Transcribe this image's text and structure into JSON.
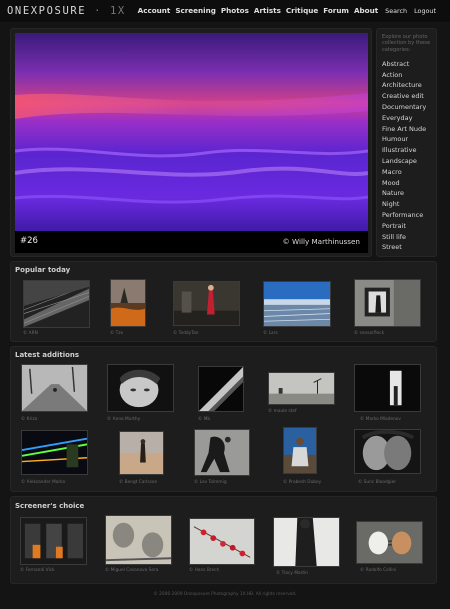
{
  "site": {
    "logo_main": "ONEXPOSURE",
    "logo_sep": "·",
    "logo_suffix": "1X"
  },
  "nav": {
    "items": [
      "Account",
      "Screening",
      "Photos",
      "Artists",
      "Critique",
      "Forum",
      "About"
    ],
    "search": "Search",
    "logout": "Logout"
  },
  "hero": {
    "number": "#26",
    "credit": "© Willy Marthinussen"
  },
  "categories": {
    "intro": "Explore our photo collection by these categories:",
    "items": [
      "Abstract",
      "Action",
      "Architecture",
      "Creative edit",
      "Documentary",
      "Everyday",
      "Fine Art Nude",
      "Humour",
      "Illustrative",
      "Landscape",
      "Macro",
      "Mood",
      "Nature",
      "Night",
      "Performance",
      "Portrait",
      "Still life",
      "Street"
    ]
  },
  "popular": {
    "title": "Popular today",
    "captions": [
      "© ARN",
      "© Tze",
      "© TeddyTan",
      "© Lars",
      "© sensorfleck"
    ]
  },
  "latest": {
    "title": "Latest additions",
    "captions": [
      "© Krizo",
      "© Anna Murthy",
      "© Mb",
      "© maule stef",
      "© Marko Mladenov",
      "© Aleksander Marko",
      "© Bengt Carlsson",
      "© Lev Tolmmig",
      "© Prabesh Dubey",
      "© Sunc Bloodgier"
    ]
  },
  "screeners": {
    "title": "Screener's choice",
    "captions": [
      "© Fernandi Vick",
      "© Miguel Casanova Sera",
      "© Hans Brech",
      "© Tracy Martin",
      "© Rodolfo Collini"
    ]
  },
  "footer": "© 2006-2009 Onexposure Photography 1X HB. All rights reserved."
}
